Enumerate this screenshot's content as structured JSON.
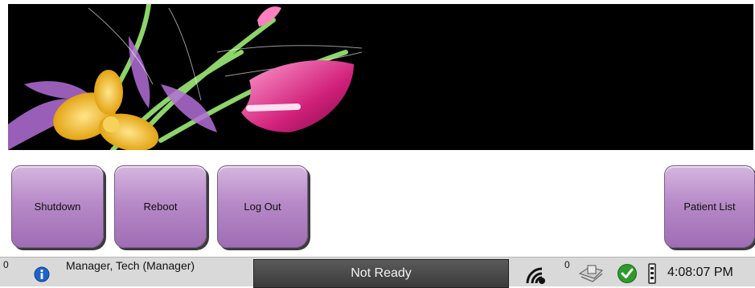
{
  "buttons": {
    "shutdown": "Shutdown",
    "reboot": "Reboot",
    "logout": "Log Out",
    "patient_list": "Patient List"
  },
  "status_bar": {
    "left_count": "0",
    "user": "Manager, Tech (Manager)",
    "system_status": "Not Ready",
    "right_count": "0",
    "time": "4:08:07 PM"
  },
  "icons": {
    "info": "info-icon",
    "wireless": "wireless-icon",
    "drive": "drive-icon",
    "check": "check-icon",
    "device": "device-icon"
  },
  "colors": {
    "tile": "#b78ac8",
    "status_bar": "#d9d9d9",
    "status_box": "#3b3b3b",
    "info_blue": "#1e64c8",
    "check_green": "#2e9a2e"
  }
}
